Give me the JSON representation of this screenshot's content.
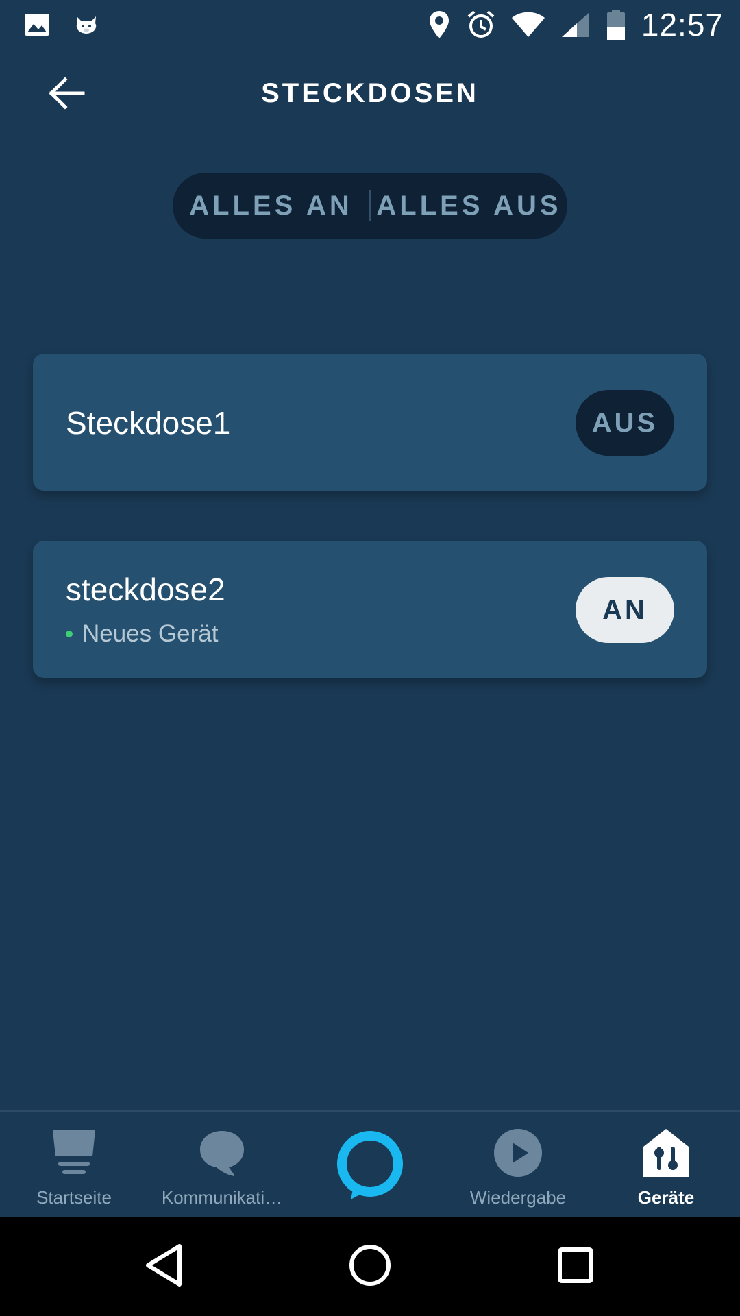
{
  "status_bar": {
    "time": "12:57",
    "icons_left": [
      "image-icon",
      "pig-icon"
    ],
    "icons_right": [
      "location-icon",
      "alarm-icon",
      "wifi-icon",
      "signal-icon",
      "battery-icon"
    ]
  },
  "header": {
    "title": "STECKDOSEN",
    "back_icon": "arrow-left-icon"
  },
  "all_controls": {
    "all_on_label": "ALLES AN",
    "all_off_label": "ALLES AUS"
  },
  "devices": [
    {
      "name": "Steckdose1",
      "subtitle": "",
      "state_label": "AUS",
      "state": "off"
    },
    {
      "name": "steckdose2",
      "subtitle": "Neues Gerät",
      "state_label": "AN",
      "state": "on"
    }
  ],
  "bottom_nav": {
    "items": [
      {
        "label": "Startseite",
        "icon": "home-card-icon"
      },
      {
        "label": "Kommunikati…",
        "icon": "speech-bubble-icon"
      },
      {
        "label": "",
        "icon": "alexa-ring-icon"
      },
      {
        "label": "Wiedergabe",
        "icon": "play-icon"
      },
      {
        "label": "Geräte",
        "icon": "devices-home-icon",
        "active": true
      }
    ]
  },
  "colors": {
    "background": "#1a3954",
    "card": "#25506f",
    "pill_dark": "#0e2135",
    "alexa_blue": "#1ab8f0",
    "new_dot": "#3ecf74"
  }
}
